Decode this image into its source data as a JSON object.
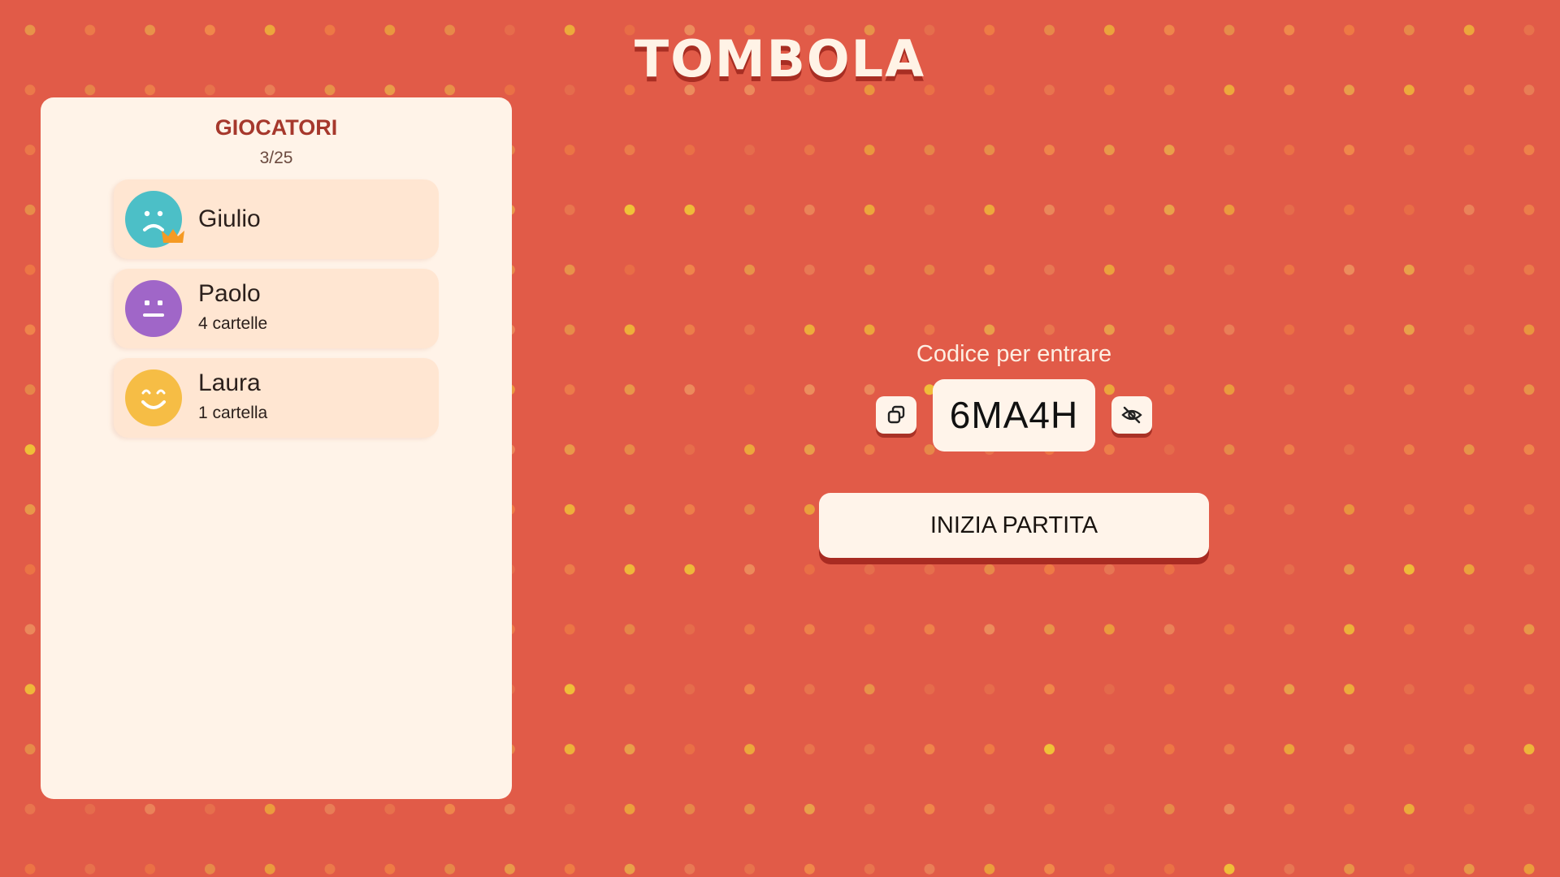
{
  "app": {
    "title": "TOMBOLA"
  },
  "players_panel": {
    "title": "GIOCATORI",
    "count": "3/25",
    "players": [
      {
        "name": "Giulio",
        "subtitle": "",
        "avatar_color": "#4cbfc7",
        "face": "sad",
        "host": true
      },
      {
        "name": "Paolo",
        "subtitle": "4 cartelle",
        "avatar_color": "#a066c8",
        "face": "neutral",
        "host": false
      },
      {
        "name": "Laura",
        "subtitle": "1 cartella",
        "avatar_color": "#f6bd45",
        "face": "happy",
        "host": false
      }
    ]
  },
  "join": {
    "label": "Codice per entrare",
    "code": "6MA4H",
    "copy_icon": "copy-icon",
    "hide_icon": "eye-off-icon"
  },
  "actions": {
    "start_label": "INIZIA PARTITA"
  },
  "colors": {
    "background": "#e15b48",
    "panel": "#fff3e8",
    "card": "#ffe6d2",
    "accent_dark": "#a82e23",
    "crown": "#f59a23"
  }
}
